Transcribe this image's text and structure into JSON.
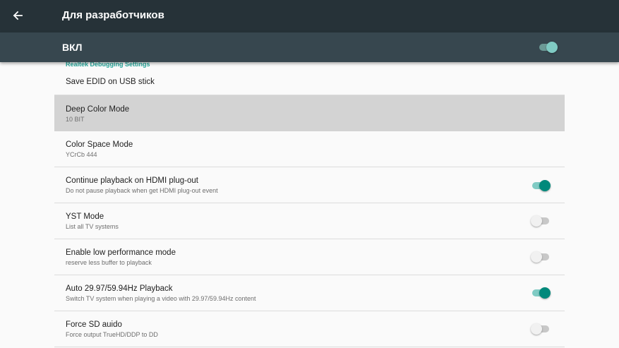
{
  "header": {
    "back_icon": "arrow-left-icon",
    "title": "Для разработчиков"
  },
  "master": {
    "label": "ВКЛ",
    "enabled": true
  },
  "category": "Realtek Debugging Settings",
  "items": [
    {
      "title": "Save EDID on USB stick",
      "summary": ""
    },
    {
      "title": "Deep Color Mode",
      "summary": "10 BIT",
      "selected": true
    },
    {
      "title": "Color Space Mode",
      "summary": "YCrCb 444"
    },
    {
      "title": "Continue playback on HDMI plug-out",
      "summary": "Do not pause playback when get HDMI plug-out event",
      "toggle": true
    },
    {
      "title": "YST Mode",
      "summary": "List all TV systems",
      "toggle": false
    },
    {
      "title": "Enable low performance mode",
      "summary": "reserve less buffer to playback",
      "toggle": false
    },
    {
      "title": "Auto 29.97/59.94Hz Playback",
      "summary": "Switch TV system when playing a video with 29.97/59.94Hz content",
      "toggle": true
    },
    {
      "title": "Force SD auido",
      "summary": "Force output TrueHD/DDP to DD",
      "toggle": false
    }
  ],
  "colors": {
    "topbar": "#263238",
    "masterbar": "#37474f",
    "accent": "#00897b",
    "accent_light": "#80cbc4",
    "category_text": "#26a69a",
    "selected_row": "#d3d3d3"
  }
}
